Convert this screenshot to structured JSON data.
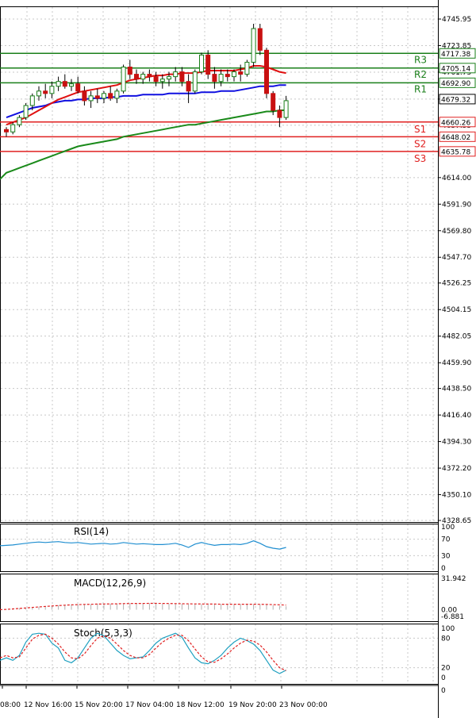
{
  "chart_data": [
    {
      "type": "candlestick",
      "price_axis_ticks": [
        "4745.95",
        "4723.85",
        "4701.75",
        "4679.32",
        "4657.55",
        "4614.00",
        "4591.90",
        "4569.80",
        "4547.70",
        "4526.25",
        "4504.15",
        "4482.05",
        "4459.90",
        "4438.50",
        "4416.40",
        "4394.30",
        "4372.20",
        "4350.10",
        "4328.65"
      ],
      "ylim": [
        4328.65,
        4752
      ],
      "time_ticks": [
        "08:00",
        "12 Nov 16:00",
        "15 Nov 20:00",
        "17 Nov 04:00",
        "18 Nov 12:00",
        "19 Nov 20:00",
        "23 Nov 00:00"
      ],
      "current_price": "4679.32",
      "levels": [
        {
          "name": "R3",
          "value": 4717.38,
          "label": "4717.38",
          "color": "#1a7f1a"
        },
        {
          "name": "R2",
          "value": 4705.14,
          "label": "4705.14",
          "color": "#1a7f1a"
        },
        {
          "name": "R1",
          "value": 4692.9,
          "label": "4692.90",
          "color": "#1a7f1a"
        },
        {
          "name": "S1",
          "value": 4660.26,
          "label": "4660.26",
          "color": "#e02020"
        },
        {
          "name": "S2",
          "value": 4648.02,
          "label": "4648.02",
          "color": "#e02020"
        },
        {
          "name": "S3",
          "value": 4635.78,
          "label": "4635.78",
          "color": "#e02020"
        }
      ],
      "candles": [
        [
          4654,
          4656,
          4648,
          4652
        ],
        [
          4652,
          4660,
          4650,
          4658
        ],
        [
          4658,
          4666,
          4656,
          4664
        ],
        [
          4664,
          4676,
          4662,
          4674
        ],
        [
          4674,
          4684,
          4670,
          4682
        ],
        [
          4682,
          4690,
          4678,
          4686
        ],
        [
          4686,
          4692,
          4680,
          4684
        ],
        [
          4684,
          4694,
          4680,
          4690
        ],
        [
          4690,
          4698,
          4686,
          4694
        ],
        [
          4694,
          4700,
          4688,
          4690
        ],
        [
          4690,
          4696,
          4686,
          4692
        ],
        [
          4692,
          4698,
          4684,
          4686
        ],
        [
          4686,
          4690,
          4674,
          4678
        ],
        [
          4678,
          4686,
          4672,
          4682
        ],
        [
          4682,
          4688,
          4676,
          4680
        ],
        [
          4680,
          4686,
          4676,
          4684
        ],
        [
          4684,
          4690,
          4678,
          4680
        ],
        [
          4680,
          4688,
          4676,
          4686
        ],
        [
          4686,
          4708,
          4684,
          4706
        ],
        [
          4706,
          4712,
          4696,
          4700
        ],
        [
          4700,
          4704,
          4692,
          4696
        ],
        [
          4696,
          4702,
          4692,
          4700
        ],
        [
          4700,
          4704,
          4694,
          4698
        ],
        [
          4698,
          4702,
          4690,
          4694
        ],
        [
          4694,
          4700,
          4688,
          4696
        ],
        [
          4696,
          4702,
          4690,
          4698
        ],
        [
          4698,
          4706,
          4694,
          4702
        ],
        [
          4702,
          4706,
          4690,
          4694
        ],
        [
          4694,
          4700,
          4676,
          4686
        ],
        [
          4686,
          4704,
          4684,
          4702
        ],
        [
          4702,
          4718,
          4700,
          4716
        ],
        [
          4716,
          4720,
          4696,
          4700
        ],
        [
          4700,
          4706,
          4688,
          4694
        ],
        [
          4694,
          4704,
          4690,
          4700
        ],
        [
          4700,
          4704,
          4694,
          4698
        ],
        [
          4698,
          4704,
          4694,
          4702
        ],
        [
          4702,
          4708,
          4694,
          4700
        ],
        [
          4700,
          4712,
          4698,
          4710
        ],
        [
          4710,
          4742,
          4706,
          4738
        ],
        [
          4738,
          4742,
          4716,
          4720
        ],
        [
          4720,
          4722,
          4680,
          4684
        ],
        [
          4684,
          4686,
          4666,
          4670
        ],
        [
          4670,
          4674,
          4656,
          4664
        ],
        [
          4664,
          4682,
          4662,
          4678
        ]
      ],
      "ma_red": [
        4658,
        4660,
        4662,
        4664,
        4667,
        4670,
        4673,
        4676,
        4679,
        4681,
        4683,
        4685,
        4686,
        4687,
        4688,
        4689,
        4690,
        4691,
        4693,
        4695,
        4696,
        4697,
        4698,
        4699,
        4699,
        4700,
        4700,
        4701,
        4701,
        4701,
        4702,
        4703,
        4703,
        4703,
        4703,
        4703,
        4704,
        4705,
        4707,
        4707,
        4706,
        4704,
        4702,
        4701
      ],
      "ma_blue": [
        4664,
        4666,
        4668,
        4670,
        4672,
        4673,
        4674,
        4676,
        4677,
        4678,
        4678,
        4679,
        4679,
        4680,
        4680,
        4680,
        4681,
        4681,
        4682,
        4682,
        4682,
        4683,
        4683,
        4683,
        4683,
        4684,
        4684,
        4684,
        4684,
        4684,
        4685,
        4685,
        4685,
        4686,
        4686,
        4686,
        4687,
        4688,
        4689,
        4690,
        4690,
        4690,
        4691,
        4691
      ],
      "ma_green": [
        4618,
        4620,
        4622,
        4624,
        4626,
        4628,
        4630,
        4632,
        4634,
        4636,
        4638,
        4640,
        4641,
        4642,
        4643,
        4644,
        4645,
        4646,
        4648,
        4649,
        4650,
        4651,
        4652,
        4653,
        4654,
        4655,
        4656,
        4657,
        4658,
        4658,
        4659,
        4660,
        4661,
        4662,
        4663,
        4664,
        4665,
        4666,
        4667,
        4668,
        4669,
        4669,
        4670,
        4670
      ]
    },
    {
      "type": "line",
      "title": "RSI(14)",
      "yticks": [
        "100",
        "70",
        "30",
        "0"
      ],
      "ylim": [
        0,
        100
      ],
      "series": [
        {
          "values": [
            55,
            56,
            58,
            60,
            62,
            63,
            62,
            63,
            64,
            62,
            61,
            62,
            60,
            58,
            59,
            60,
            58,
            59,
            62,
            60,
            58,
            59,
            58,
            57,
            57,
            58,
            60,
            56,
            50,
            58,
            62,
            58,
            55,
            57,
            57,
            58,
            57,
            60,
            66,
            60,
            52,
            48,
            46,
            50
          ]
        }
      ]
    },
    {
      "type": "bar",
      "title": "MACD(12,26,9)",
      "yticks": [
        "31.942",
        "0.00",
        "-6.881"
      ],
      "ylim": [
        -6.881,
        31.942
      ],
      "values": [
        0.5,
        1,
        1.5,
        2,
        2.5,
        3,
        3.5,
        4,
        4.5,
        5,
        5,
        5.5,
        5.5,
        5.5,
        6,
        6,
        6,
        6,
        6.5,
        6.5,
        6.5,
        6.5,
        6.5,
        6.5,
        6,
        6,
        6,
        6,
        5.5,
        5.5,
        5.5,
        5.5,
        5.5,
        5.5,
        5.5,
        5.5,
        5.5,
        5.5,
        5.5,
        5.5,
        5,
        4.5,
        4,
        3.5
      ],
      "signal": [
        0.3,
        0.8,
        1.3,
        1.8,
        2.3,
        2.8,
        3.3,
        3.8,
        4.2,
        4.6,
        4.9,
        5.2,
        5.4,
        5.5,
        5.7,
        5.8,
        5.9,
        6.0,
        6.2,
        6.3,
        6.4,
        6.4,
        6.5,
        6.5,
        6.4,
        6.3,
        6.2,
        6.1,
        6.0,
        5.9,
        5.8,
        5.7,
        5.7,
        5.6,
        5.6,
        5.6,
        5.6,
        5.6,
        5.6,
        5.5,
        5.4,
        5.2,
        5.0,
        4.7
      ]
    },
    {
      "type": "line",
      "title": "Stoch(5,3,3)",
      "yticks": [
        "100",
        "80",
        "20",
        "0"
      ],
      "ylim": [
        0,
        100
      ],
      "series": [
        {
          "values": [
            40,
            35,
            45,
            72,
            88,
            90,
            88,
            70,
            60,
            35,
            30,
            40,
            60,
            80,
            90,
            85,
            70,
            55,
            45,
            38,
            40,
            42,
            55,
            70,
            80,
            85,
            90,
            82,
            60,
            40,
            30,
            28,
            35,
            45,
            60,
            72,
            80,
            75,
            68,
            55,
            35,
            15,
            8,
            15
          ],
          "color": "#1fa0c0"
        },
        {
          "values": [
            45,
            40,
            42,
            60,
            78,
            86,
            88,
            80,
            68,
            52,
            40,
            38,
            48,
            65,
            80,
            85,
            80,
            68,
            55,
            45,
            40,
            40,
            47,
            60,
            72,
            80,
            86,
            86,
            75,
            58,
            42,
            32,
            31,
            38,
            48,
            60,
            70,
            76,
            74,
            66,
            52,
            35,
            20,
            14
          ],
          "color": "#e02020"
        }
      ]
    }
  ]
}
